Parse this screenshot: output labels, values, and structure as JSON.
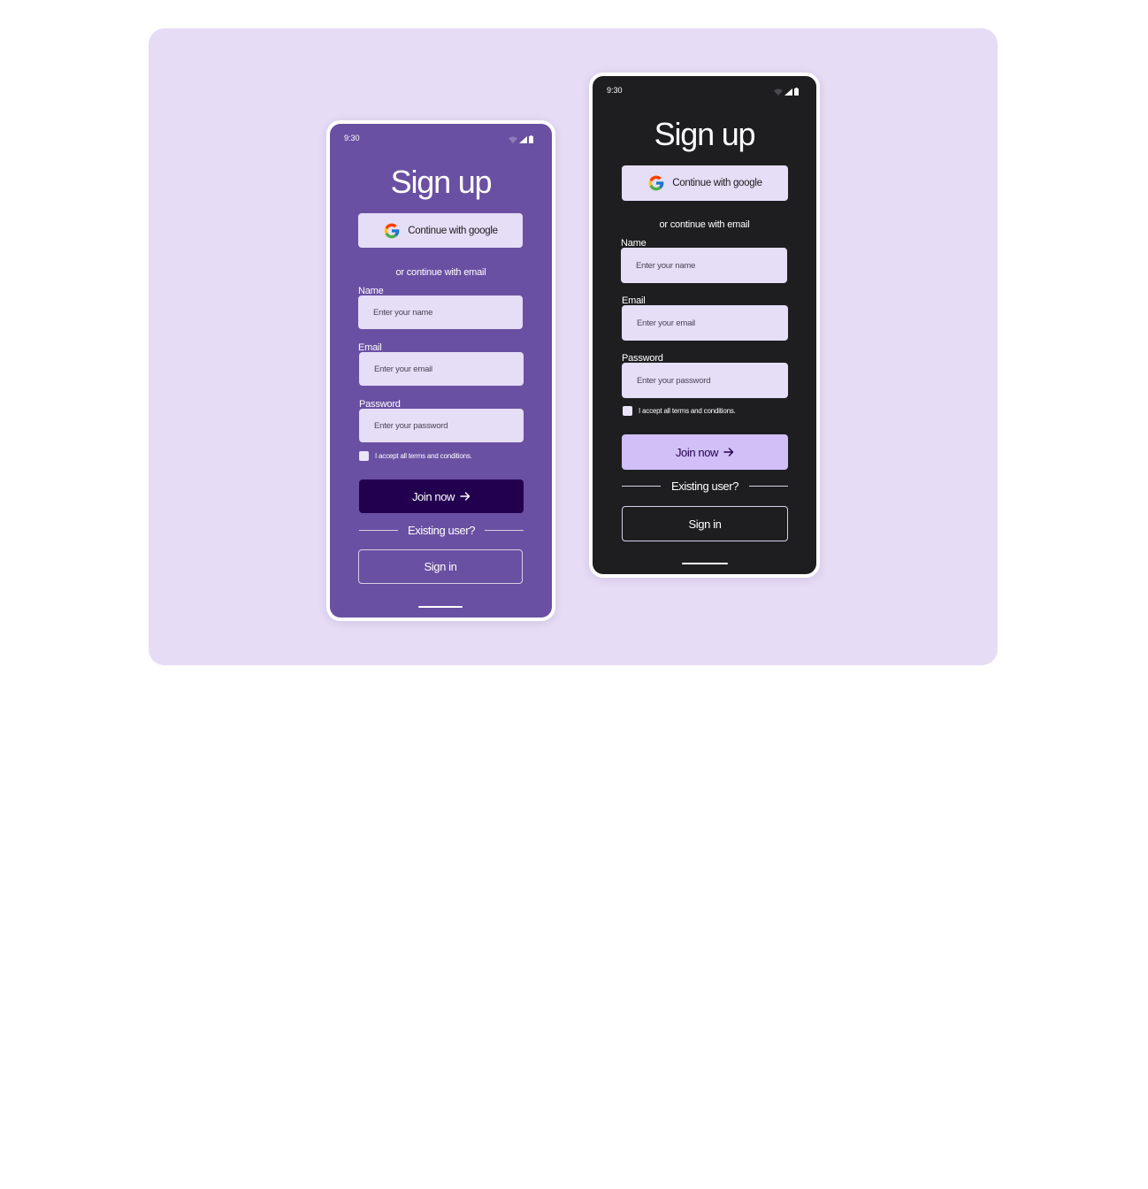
{
  "screens": [
    {
      "theme": "purple",
      "status_time": "9:30",
      "title": "Sign up",
      "google_label": "Continue with google",
      "or_text": "or continue with email",
      "name_label": "Name",
      "name_placeholder": "Enter your name",
      "email_label": "Email",
      "email_placeholder": "Enter your email",
      "password_label": "Password",
      "password_placeholder": "Enter your password",
      "terms_text": "I accept all terms and conditions.",
      "join_label": "Join now",
      "existing_text": "Existing user?",
      "signin_label": "Sign in"
    },
    {
      "theme": "dark",
      "status_time": "9:30",
      "title": "Sign up",
      "google_label": "Continue with google",
      "or_text": "or continue with email",
      "name_label": "Name",
      "name_placeholder": "Enter your name",
      "email_label": "Email",
      "email_placeholder": "Enter your email",
      "password_label": "Password",
      "password_placeholder": "Enter your password",
      "terms_text": "I accept all terms and conditions.",
      "join_label": "Join now",
      "existing_text": "Existing user?",
      "signin_label": "Sign in"
    }
  ],
  "colors": {
    "canvas_bg": "#e6dcf5",
    "purple_screen_bg": "#6a50a2",
    "dark_screen_bg": "#1e1e20",
    "input_bg": "#e6ddf6",
    "join_purple_bg": "#23004f",
    "join_dark_bg": "#d1bff7"
  },
  "icons": {
    "google": "google-icon",
    "arrow": "arrow-right-icon",
    "wifi": "wifi-icon",
    "signal": "signal-icon",
    "battery": "battery-icon"
  }
}
